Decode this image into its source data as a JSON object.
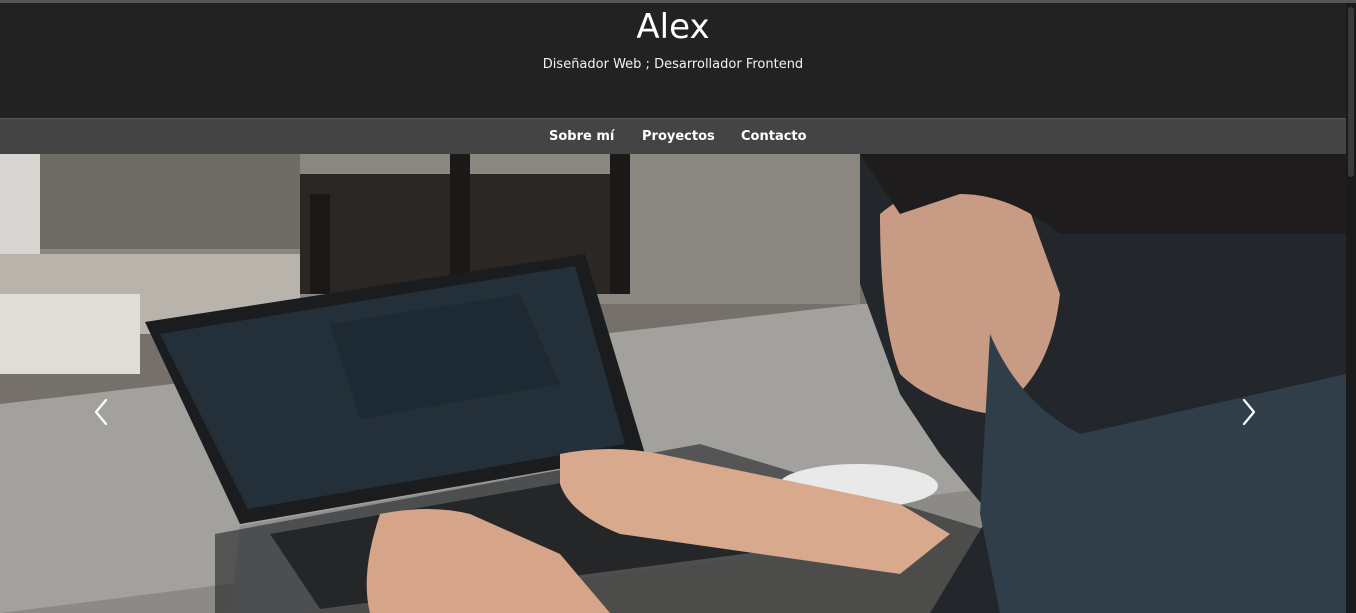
{
  "header": {
    "title": "Alex",
    "subtitle": "Diseñador Web ; Desarrollador Frontend"
  },
  "nav": {
    "items": [
      {
        "label": "Sobre mí"
      },
      {
        "label": "Proyectos"
      },
      {
        "label": "Contacto"
      }
    ]
  },
  "carousel": {
    "prev_icon": "chevron-left-icon",
    "next_icon": "chevron-right-icon",
    "slide_description": "photo"
  },
  "colors": {
    "header_bg": "#222222",
    "nav_bg": "#444444",
    "text": "#ffffff"
  }
}
